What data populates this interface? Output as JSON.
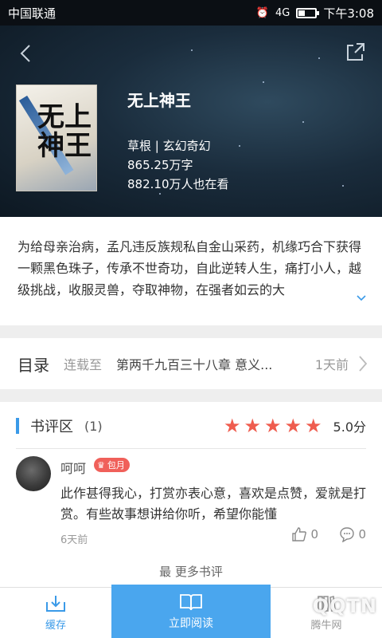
{
  "status_bar": {
    "carrier": "中国联通",
    "signal": "4G",
    "time": "下午3:08"
  },
  "book": {
    "title": "无上神王",
    "cover_title": "无上神王",
    "meta_line": "草根 | 玄幻奇幻",
    "word_count": "865.25万字",
    "readers": "882.10万人也在看",
    "description": "为给母亲治病，孟凡违反族规私自金山采药，机缘巧合下获得一颗黑色珠子，传承不世奇功，自此逆转人生，痛打小人，越级挑战，收服灵兽，夺取神物，在强者如云的大"
  },
  "catalog": {
    "label": "目录",
    "status": "连载至",
    "latest_chapter": "第两千九百三十八章 意义...",
    "updated": "1天前"
  },
  "reviews": {
    "title": "书评区",
    "count": "(1)",
    "rating": 5,
    "score": "5.0分",
    "items": [
      {
        "user": "呵呵",
        "badge": "包月",
        "text": "此作甚得我心，打赏亦表心意，喜欢是点赞，爱就是打赏。有些故事想讲给你听，希望你能懂",
        "time": "6天前",
        "likes": "0",
        "comments": "0"
      }
    ],
    "more_label": "最 更多书评"
  },
  "bottom_bar": {
    "download": "缓存",
    "read_now": "立即阅读",
    "shelf": "腾牛网"
  },
  "watermark": "QQTN",
  "colors": {
    "accent": "#3a9ae8",
    "star": "#ef5c4e",
    "badge": "#f0605a"
  }
}
